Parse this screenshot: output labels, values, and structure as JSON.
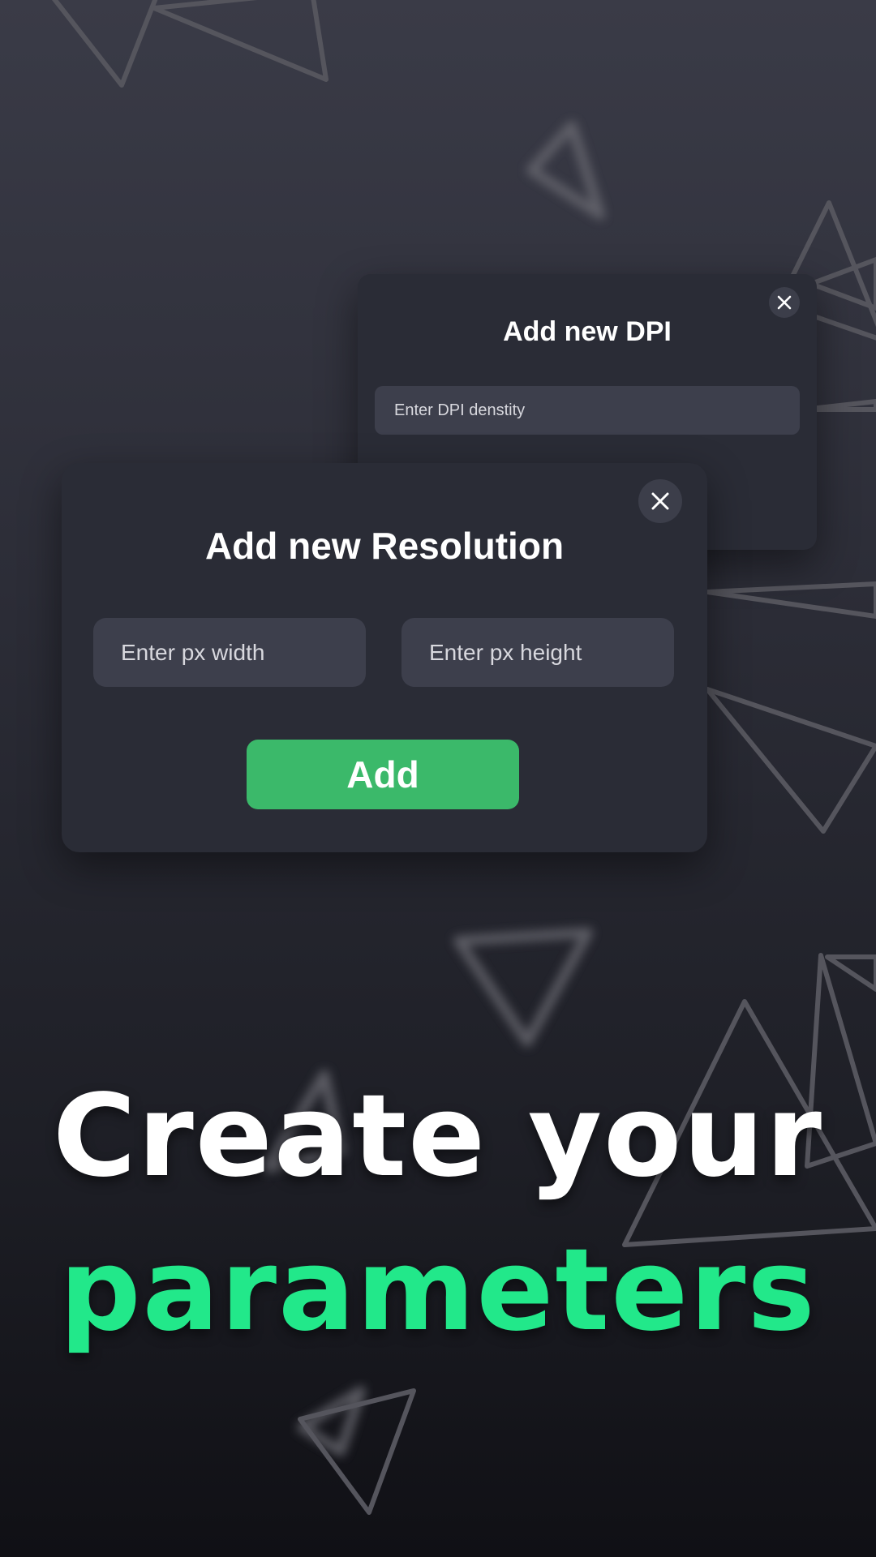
{
  "dpi_dialog": {
    "title": "Add new DPI",
    "input_placeholder": "Enter DPI denstity",
    "close_icon": "close-icon"
  },
  "resolution_dialog": {
    "title": "Add new Resolution",
    "width_placeholder": "Enter px width",
    "height_placeholder": "Enter px height",
    "add_label": "Add",
    "close_icon": "close-icon"
  },
  "headline": {
    "line1": "Create your",
    "line2": "parameters"
  },
  "colors": {
    "accent_green": "#22e88a",
    "button_green": "#3bb96a",
    "card_bg": "#2a2c36",
    "field_bg": "#3d3f4c"
  }
}
